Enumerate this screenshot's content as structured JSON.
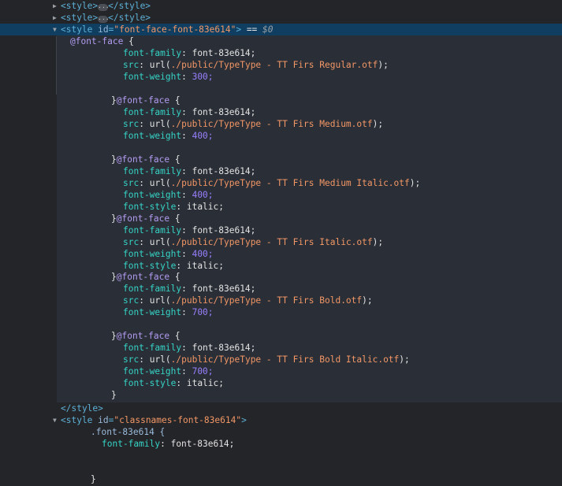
{
  "rows": {
    "r1": {
      "open": "<style>",
      "close": "</style>"
    },
    "r2": {
      "open": "<style>",
      "close": "</style>"
    },
    "r3": {
      "tag_open": "<style",
      "attr": "id",
      "value": "\"font-face-font-83e614\"",
      "tag_end": ">",
      "eq": " == ",
      "dollar": "$0"
    },
    "close_style": "</style>",
    "r_class": {
      "tag_open": "<style",
      "attr": "id",
      "value": "\"classnames-font-83e614\"",
      "tag_end": ">"
    },
    "class_selector": ".font-83e614 {",
    "class_prop": "font-family",
    "class_value": "font-83e614;",
    "class_brace": "}"
  },
  "faces": [
    {
      "prefix": "",
      "at": "@font-face",
      "family": "font-83e614;",
      "src_fn": "url(",
      "src_path": "./public/TypeType - TT Firs Regular.otf",
      "src_end": ");",
      "weight": "300;",
      "style": null
    },
    {
      "prefix": "}",
      "at": "@font-face",
      "family": "font-83e614;",
      "src_fn": "url(",
      "src_path": "./public/TypeType - TT Firs Medium.otf",
      "src_end": ");",
      "weight": "400;",
      "style": null
    },
    {
      "prefix": "}",
      "at": "@font-face",
      "family": "font-83e614;",
      "src_fn": "url(",
      "src_path": "./public/TypeType - TT Firs Medium Italic.otf",
      "src_end": ");",
      "weight": "400;",
      "style": "italic;"
    },
    {
      "prefix": "}",
      "at": "@font-face",
      "family": "font-83e614;",
      "src_fn": "url(",
      "src_path": "./public/TypeType - TT Firs Italic.otf",
      "src_end": ");",
      "weight": "400;",
      "style": "italic;"
    },
    {
      "prefix": "}",
      "at": "@font-face",
      "family": "font-83e614;",
      "src_fn": "url(",
      "src_path": "./public/TypeType - TT Firs Bold.otf",
      "src_end": ");",
      "weight": "700;",
      "style": null
    },
    {
      "prefix": "}",
      "at": "@font-face",
      "family": "font-83e614;",
      "src_fn": "url(",
      "src_path": "./public/TypeType - TT Firs Bold Italic.otf",
      "src_end": ");",
      "weight": "700;",
      "style": "italic;"
    }
  ],
  "labels": {
    "family": "font-family",
    "src": "src",
    "weight": "font-weight",
    "style": "font-style",
    "colon": ": ",
    "brace_open": " {",
    "final_brace": "}"
  },
  "icons": {
    "collapsed": "collapsed-triangle-icon",
    "expanded": "expanded-triangle-icon",
    "ellipsis": "ellipsis-icon"
  },
  "colors": {
    "background": "#242528",
    "selected_row": "#0f3e61",
    "tag": "#5db0d7",
    "attribute_value": "#f29766",
    "css_property": "#35d4c7",
    "number": "#9980ff"
  }
}
